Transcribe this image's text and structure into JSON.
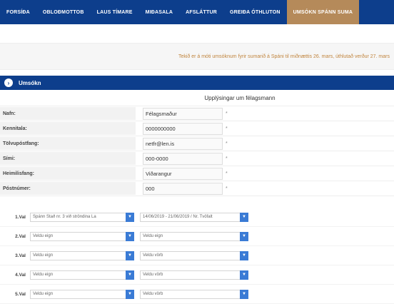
{
  "nav": {
    "items": [
      {
        "label": "FORSÍÐA",
        "active": false
      },
      {
        "label": "OBLOÐMOTTOB",
        "active": false
      },
      {
        "label": "LAUS TÍMARE",
        "active": false
      },
      {
        "label": "MIÐASALA",
        "active": false
      },
      {
        "label": "AFSLÁTTUR",
        "active": false
      },
      {
        "label": "GREIÐA ÓTHLUTON",
        "active": false
      },
      {
        "label": "UMSÓKN SPÁNN SUMA",
        "active": true
      }
    ],
    "active_color": "#b58a5a",
    "bg_color": "#0d3e8c"
  },
  "notice": {
    "text": "Tekið er á móti umsóknum fyrir sumarið á Spáni til miðnættis 26. mars, úthlutað verður 27. mars"
  },
  "section": {
    "icon": "circle-arrow-icon",
    "title": "Umsókn",
    "subtitle": "Upplýsingar um félagsmann"
  },
  "member_fields": [
    {
      "label": "Nafn:",
      "value": "Félagsmaður"
    },
    {
      "label": "Kennitala:",
      "value": "0000000000"
    },
    {
      "label": "Tölvupóstfang:",
      "value": "netfr@len.is"
    },
    {
      "label": "Sími:",
      "value": "000-0000"
    },
    {
      "label": "Heimilisfang:",
      "value": "Viðarangur"
    },
    {
      "label": "Póstnúmer:",
      "value": "000"
    }
  ],
  "required_marker": "*",
  "choices": [
    {
      "label": "1.Val",
      "location": "Spánn Stað nr. 3 við ströndina La",
      "dates": "14/06/2019 - 21/06/2019 / Nr. Tvöfalt"
    },
    {
      "label": "2.Val",
      "location": "Veldu eign",
      "dates": "Veldu eign"
    },
    {
      "label": "3.Val",
      "location": "Veldu eign",
      "dates": "Veldu vörb"
    },
    {
      "label": "4.Val",
      "location": "Veldu eign",
      "dates": "Veldu vörb"
    },
    {
      "label": "5.Val",
      "location": "Veldu eign",
      "dates": "Veldu vörb"
    }
  ]
}
